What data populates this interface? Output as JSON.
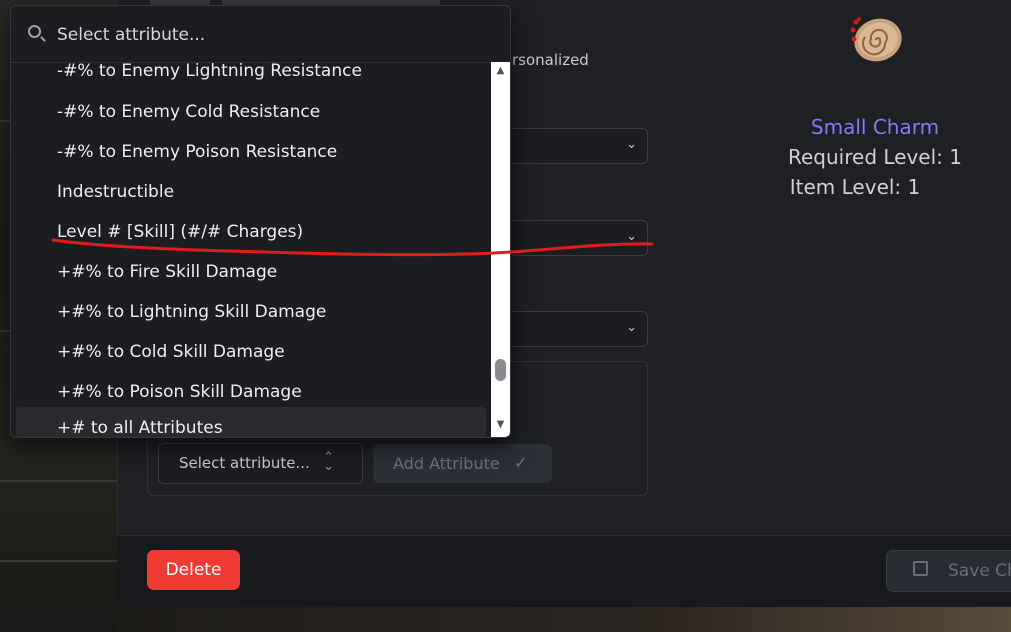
{
  "dropdown": {
    "search_placeholder": "Select attribute...",
    "options": [
      "-#% to Enemy Lightning Resistance",
      "-#% to Enemy Cold Resistance",
      "-#% to Enemy Poison Resistance",
      "Indestructible",
      "Level # [Skill] (#/# Charges)",
      "+#% to Fire Skill Damage",
      "+#% to Lightning Skill Damage",
      "+#% to Cold Skill Damage",
      "+#% to Poison Skill Damage",
      "+# to all Attributes"
    ],
    "highlighted_index": 9
  },
  "form": {
    "personalized_text": "rsonalized",
    "attribute_select_label": "Select attribute...",
    "add_attribute_label": "Add Attribute"
  },
  "item": {
    "name": "Small Charm",
    "required_level": "Required Level: 1",
    "item_level": "Item Level: 1",
    "name_color": "#7e7ef2"
  },
  "footer": {
    "delete_label": "Delete",
    "save_label": "Save Ch"
  },
  "colors": {
    "delete": "#ef3b33",
    "annotation": "#e31b1b"
  }
}
